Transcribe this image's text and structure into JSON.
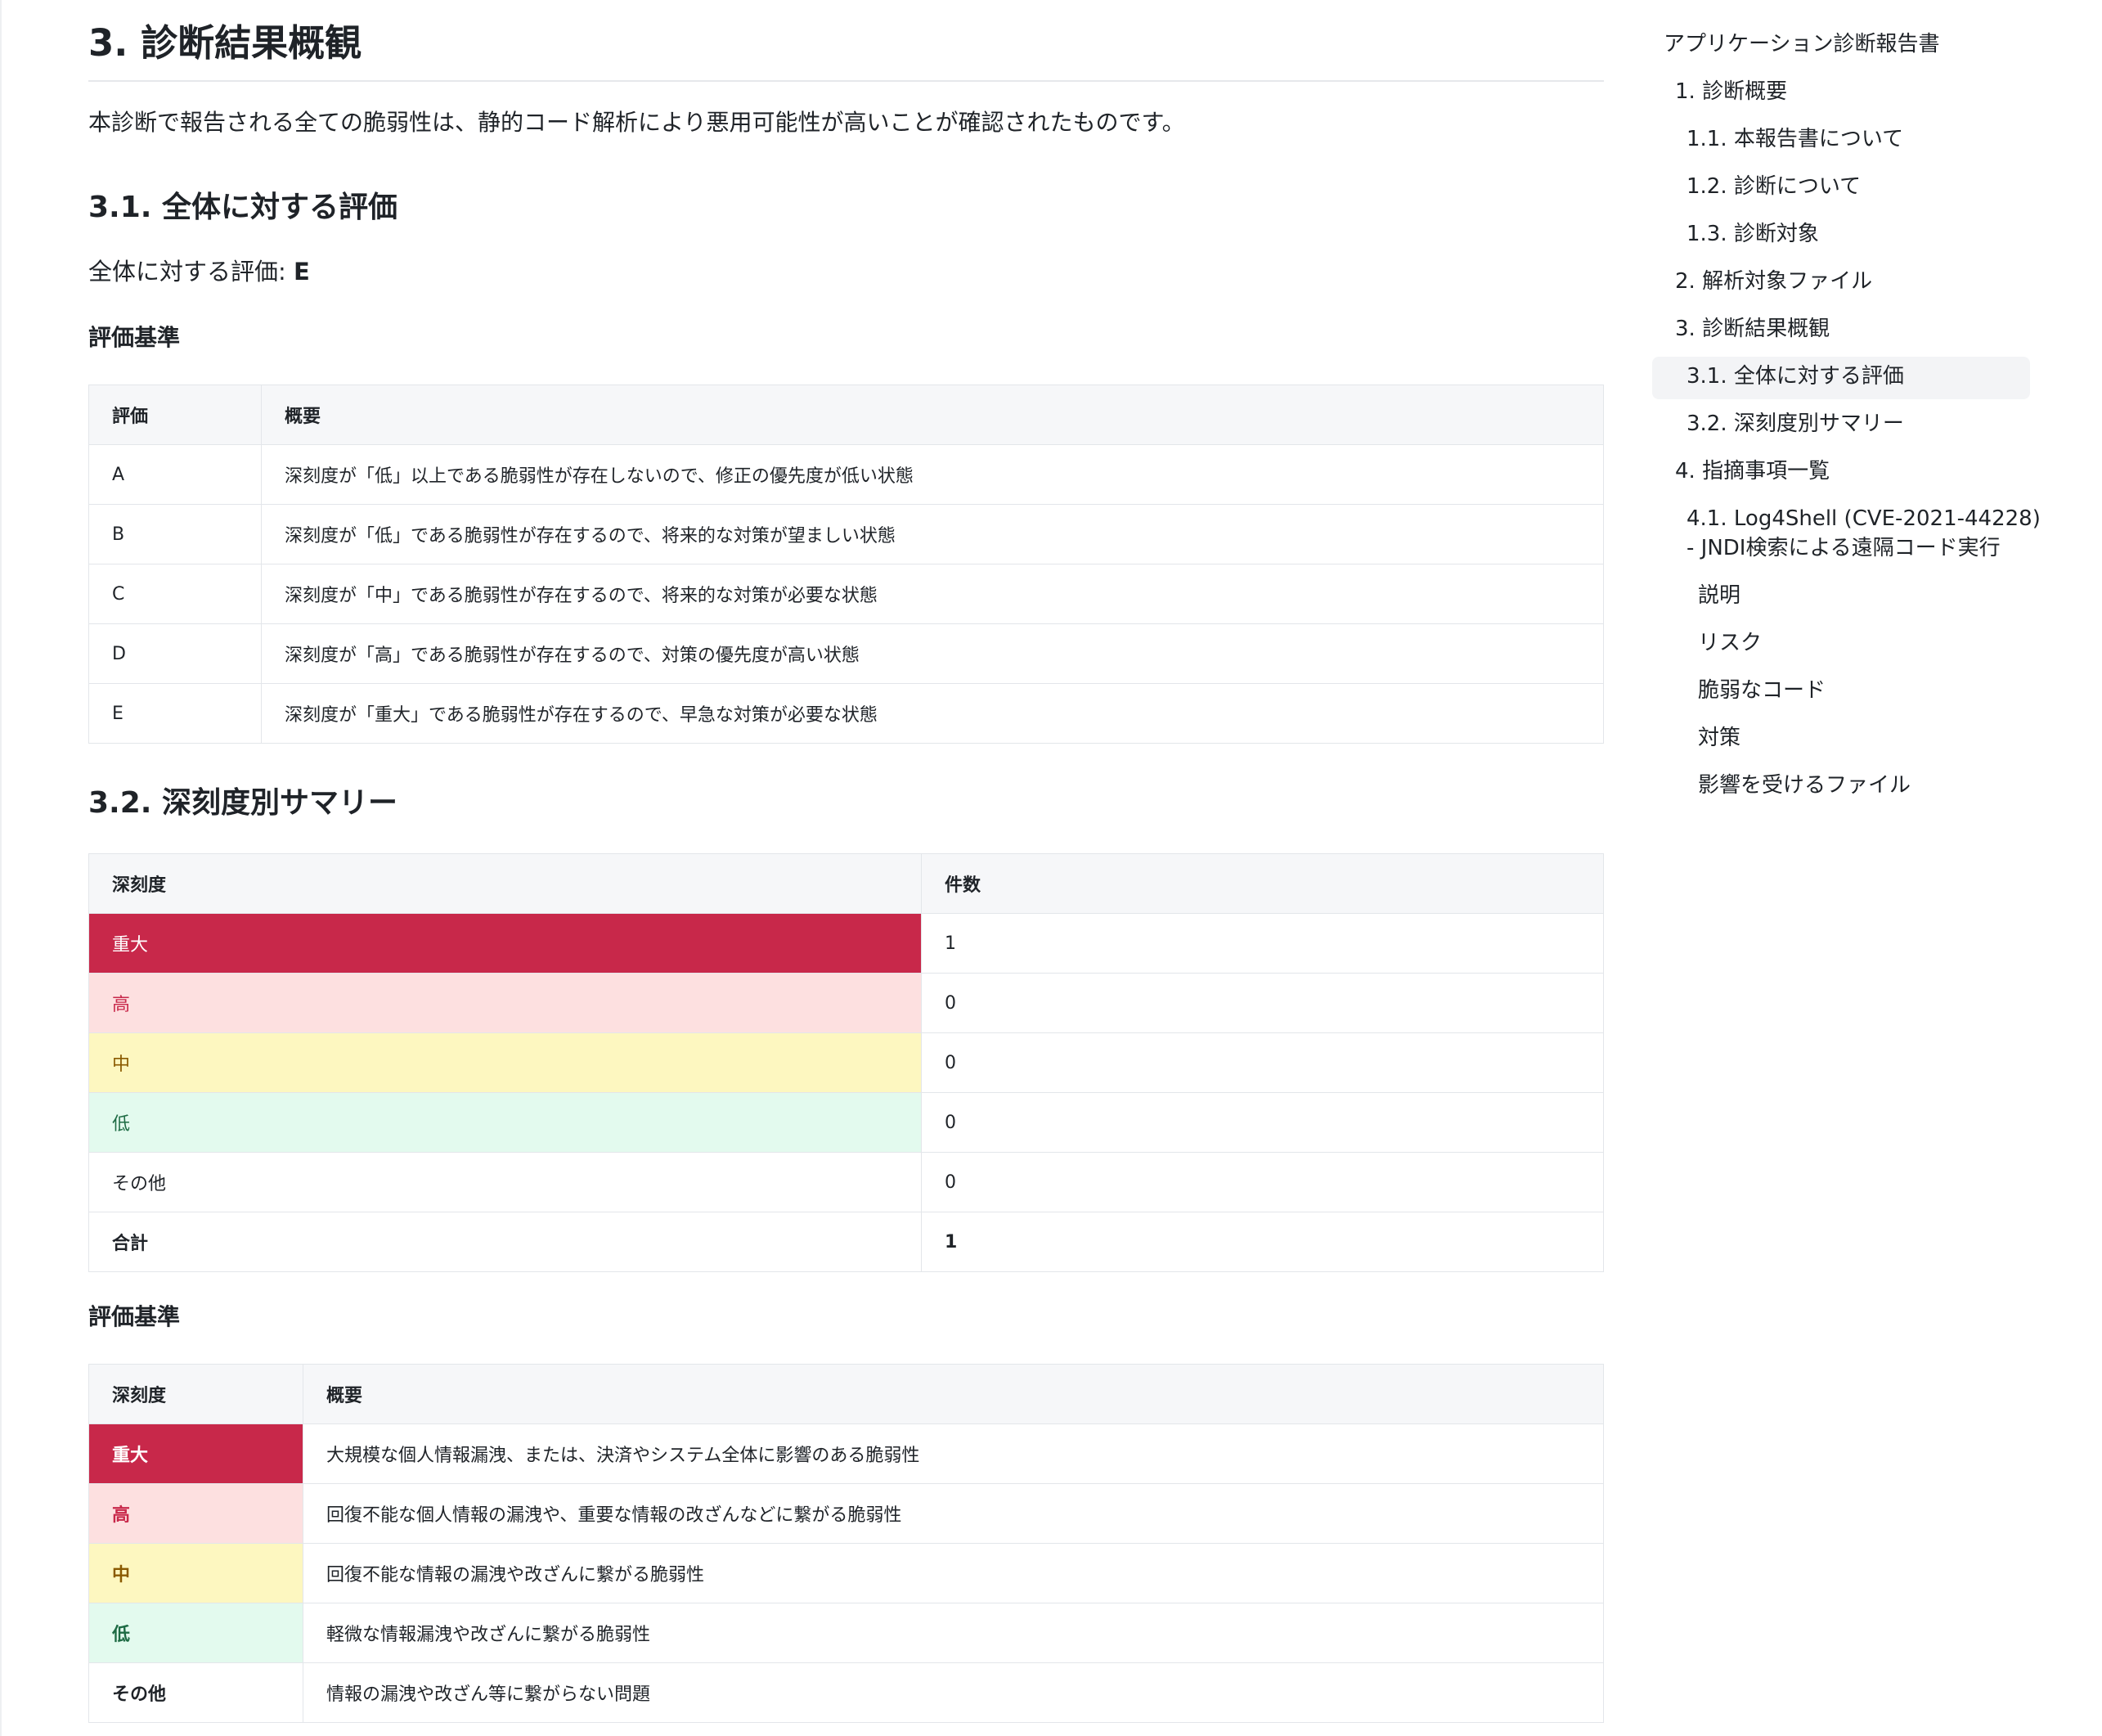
{
  "section": {
    "title": "3. 診断結果概観",
    "intro": "本診断で報告される全ての脆弱性は、静的コード解析により悪用可能性が高いことが確認されたものです。"
  },
  "overall": {
    "heading": "3.1. 全体に対する評価",
    "label": "全体に対する評価: ",
    "value": "E",
    "criteria_heading": "評価基準",
    "criteria_columns": [
      "評価",
      "概要"
    ],
    "criteria_rows": [
      {
        "grade": "A",
        "desc": "深刻度が「低」以上である脆弱性が存在しないので、修正の優先度が低い状態"
      },
      {
        "grade": "B",
        "desc": "深刻度が「低」である脆弱性が存在するので、将来的な対策が望ましい状態"
      },
      {
        "grade": "C",
        "desc": "深刻度が「中」である脆弱性が存在するので、将来的な対策が必要な状態"
      },
      {
        "grade": "D",
        "desc": "深刻度が「高」である脆弱性が存在するので、対策の優先度が高い状態"
      },
      {
        "grade": "E",
        "desc": "深刻度が「重大」である脆弱性が存在するので、早急な対策が必要な状態"
      }
    ]
  },
  "summary": {
    "heading": "3.2. 深刻度別サマリー",
    "columns": [
      "深刻度",
      "件数"
    ],
    "rows": [
      {
        "severity": "重大",
        "count": "1"
      },
      {
        "severity": "高",
        "count": "0"
      },
      {
        "severity": "中",
        "count": "0"
      },
      {
        "severity": "低",
        "count": "0"
      },
      {
        "severity": "その他",
        "count": "0"
      },
      {
        "severity": "合計",
        "count": "1"
      }
    ],
    "criteria_heading": "評価基準",
    "criteria_columns": [
      "深刻度",
      "概要"
    ],
    "criteria_rows": [
      {
        "severity": "重大",
        "desc": "大規模な個人情報漏洩、または、決済やシステム全体に影響のある脆弱性"
      },
      {
        "severity": "高",
        "desc": "回復不能な個人情報の漏洩や、重要な情報の改ざんなどに繋がる脆弱性"
      },
      {
        "severity": "中",
        "desc": "回復不能な情報の漏洩や改ざんに繋がる脆弱性"
      },
      {
        "severity": "低",
        "desc": "軽微な情報漏洩や改ざんに繋がる脆弱性"
      },
      {
        "severity": "その他",
        "desc": "情報の漏洩や改ざん等に繋がらない問題"
      }
    ]
  },
  "colors": {
    "critical": "#c8284a",
    "high_bg": "#fde0e0",
    "medium_bg": "#fdf7c0",
    "low_bg": "#e3faee"
  },
  "toc": {
    "title": "アプリケーション診断報告書",
    "items": [
      "1. 診断概要",
      "1.1. 本報告書について",
      "1.2. 診断について",
      "1.3. 診断対象",
      "2. 解析対象ファイル",
      "3. 診断結果概観",
      "3.1. 全体に対する評価",
      "3.2. 深刻度別サマリー",
      "4. 指摘事項一覧",
      "4.1. Log4Shell (CVE-2021-44228)",
      "- JNDI検索による遠隔コード実行",
      "説明",
      "リスク",
      "脆弱なコード",
      "対策",
      "影響を受けるファイル"
    ]
  }
}
